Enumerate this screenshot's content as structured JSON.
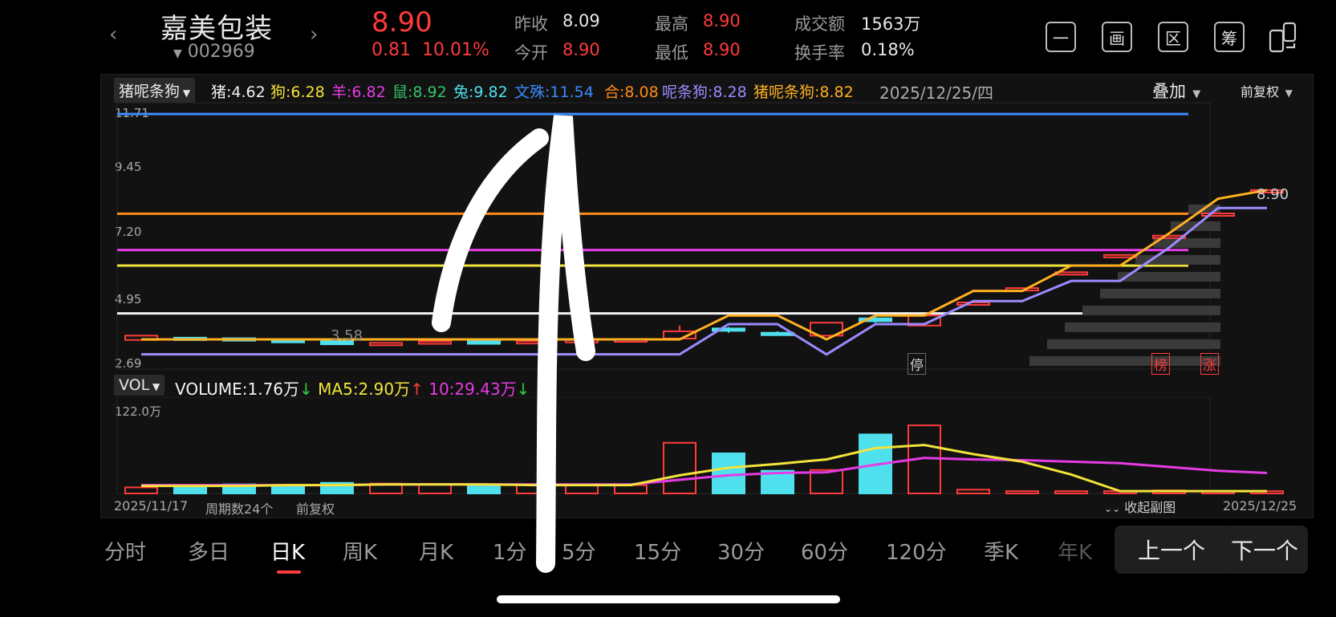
{
  "header": {
    "prev_label": "‹",
    "next_label": "›",
    "name": "嘉美包装",
    "code": "002969",
    "price": "8.90",
    "change": "0.81",
    "change_pct": "10.01%",
    "quotes": [
      {
        "label": "昨收",
        "value": "8.09",
        "color": "#e8e8e8"
      },
      {
        "label": "今开",
        "value": "8.90",
        "color": "#ff3b3b"
      },
      {
        "label": "最高",
        "value": "8.90",
        "color": "#ff3b3b"
      },
      {
        "label": "最低",
        "value": "8.90",
        "color": "#ff3b3b"
      },
      {
        "label": "成交额",
        "value": "1563万",
        "color": "#e8e8e8"
      },
      {
        "label": "换手率",
        "value": "0.18%",
        "color": "#e8e8e8"
      }
    ],
    "tools": [
      "一",
      "画",
      "区",
      "筹"
    ]
  },
  "indicator": {
    "selector": "猪呢条狗",
    "items": [
      {
        "text": "猪:4.62",
        "color": "#f2f2f2"
      },
      {
        "text": "狗:6.28",
        "color": "#f3e33a"
      },
      {
        "text": "羊:6.82",
        "color": "#e53be5"
      },
      {
        "text": "鼠:8.92",
        "color": "#36c46a"
      },
      {
        "text": "兔:9.82",
        "color": "#4fe0ee"
      },
      {
        "text": "文殊:11.54",
        "color": "#3d8bff"
      },
      {
        "text": "合:8.08",
        "color": "#ff8a1a"
      },
      {
        "text": "呢条狗:8.28",
        "color": "#9b8bff"
      },
      {
        "text": "猪呢条狗:8.82",
        "color": "#ffb020"
      }
    ],
    "date": "2025/12/25/四",
    "overlay": "叠加",
    "adjust": "前复权"
  },
  "price_axis": [
    "11.71",
    "9.45",
    "7.20",
    "4.95",
    "2.69"
  ],
  "low_label": "3.58",
  "last_label": "8.90",
  "markers": [
    {
      "text": "停",
      "color": "#cfcfcf"
    },
    {
      "text": "榜",
      "color": "#ff3b3b"
    },
    {
      "text": "涨",
      "color": "#ff3b3b"
    }
  ],
  "volume": {
    "selector": "VOL",
    "vol_text": "VOLUME:1.76万",
    "vol_arrow": "↓",
    "ma5_text": "MA5:2.90万",
    "ma5_arrow": "↑",
    "ma10_text": "10:29.43万",
    "ma10_arrow": "↓",
    "axis_max": "122.0万"
  },
  "footer": {
    "start_date": "2025/11/17",
    "period_count": "周期数24个",
    "adjust": "前复权",
    "collapse": "收起副图",
    "end_date": "2025/12/25"
  },
  "period_tabs": [
    "分时",
    "多日",
    "日K",
    "周K",
    "月K",
    "1分",
    "5分",
    "15分",
    "30分",
    "60分",
    "120分",
    "季K",
    "年K"
  ],
  "active_tab": "日K",
  "pager": {
    "prev": "上一个",
    "next": "下一个"
  },
  "chart_data": {
    "type": "candlestick",
    "ylim": [
      2.69,
      11.71
    ],
    "horizontal_lines": [
      {
        "value": 11.54,
        "color": "#3d8bff"
      },
      {
        "value": 8.08,
        "color": "#ff8a1a"
      },
      {
        "value": 6.82,
        "color": "#e53be5"
      },
      {
        "value": 6.28,
        "color": "#f3e33a"
      },
      {
        "value": 4.62,
        "color": "#f2f2f2"
      }
    ],
    "candles": [
      {
        "o": 3.85,
        "c": 3.7,
        "h": 3.85,
        "l": 3.7,
        "up": true
      },
      {
        "o": 3.78,
        "c": 3.74,
        "h": 3.78,
        "l": 3.72,
        "up": false
      },
      {
        "o": 3.76,
        "c": 3.72,
        "h": 3.76,
        "l": 3.7,
        "up": false
      },
      {
        "o": 3.7,
        "c": 3.68,
        "h": 3.72,
        "l": 3.66,
        "up": false
      },
      {
        "o": 3.7,
        "c": 3.55,
        "h": 3.72,
        "l": 3.55,
        "up": false
      },
      {
        "o": 3.6,
        "c": 3.58,
        "h": 3.6,
        "l": 3.55,
        "up": true
      },
      {
        "o": 3.6,
        "c": 3.65,
        "h": 3.65,
        "l": 3.6,
        "up": true
      },
      {
        "o": 3.65,
        "c": 3.62,
        "h": 3.66,
        "l": 3.6,
        "up": false
      },
      {
        "o": 3.6,
        "c": 3.66,
        "h": 3.66,
        "l": 3.6,
        "up": true
      },
      {
        "o": 3.68,
        "c": 3.7,
        "h": 3.7,
        "l": 3.68,
        "up": true
      },
      {
        "o": 3.7,
        "c": 3.72,
        "h": 3.72,
        "l": 3.7,
        "up": true
      },
      {
        "o": 3.75,
        "c": 4.0,
        "h": 4.2,
        "l": 3.75,
        "up": true
      },
      {
        "o": 4.1,
        "c": 4.05,
        "h": 4.15,
        "l": 3.95,
        "up": false
      },
      {
        "o": 3.95,
        "c": 3.9,
        "h": 4.0,
        "l": 3.85,
        "up": false
      },
      {
        "o": 3.85,
        "c": 4.3,
        "h": 4.3,
        "l": 3.85,
        "up": true
      },
      {
        "o": 4.35,
        "c": 4.45,
        "h": 4.5,
        "l": 4.3,
        "up": false
      },
      {
        "o": 4.2,
        "c": 4.55,
        "h": 4.55,
        "l": 4.2,
        "up": true
      },
      {
        "o": 5.0,
        "c": 5.0,
        "h": 5.0,
        "l": 5.0,
        "up": true
      },
      {
        "o": 5.5,
        "c": 5.5,
        "h": 5.5,
        "l": 5.5,
        "up": true
      },
      {
        "o": 6.05,
        "c": 6.05,
        "h": 6.05,
        "l": 6.05,
        "up": true
      },
      {
        "o": 6.65,
        "c": 6.65,
        "h": 6.65,
        "l": 6.65,
        "up": true
      },
      {
        "o": 7.32,
        "c": 7.32,
        "h": 7.32,
        "l": 7.32,
        "up": true
      },
      {
        "o": 8.09,
        "c": 8.09,
        "h": 8.09,
        "l": 8.09,
        "up": true
      },
      {
        "o": 8.9,
        "c": 8.9,
        "h": 8.9,
        "l": 8.9,
        "up": true
      }
    ],
    "line_yellow": [
      3.72,
      3.72,
      3.72,
      3.72,
      3.72,
      3.72,
      3.72,
      3.72,
      3.72,
      3.72,
      3.72,
      3.72,
      4.55,
      4.55,
      3.72,
      4.55,
      4.55,
      5.4,
      5.4,
      6.28,
      6.28,
      7.4,
      8.6,
      8.9
    ],
    "line_purple": [
      3.2,
      3.2,
      3.2,
      3.2,
      3.2,
      3.2,
      3.2,
      3.2,
      3.2,
      3.2,
      3.2,
      3.2,
      4.25,
      4.25,
      3.2,
      4.25,
      4.25,
      5.05,
      5.05,
      5.75,
      5.75,
      6.9,
      8.28,
      8.28
    ],
    "volume_bars": [
      8,
      9,
      12,
      9,
      14,
      13,
      12,
      10,
      11,
      11,
      11,
      67,
      53,
      30,
      31,
      78,
      90,
      5,
      3,
      3,
      3,
      4,
      3,
      3
    ],
    "volume_up": [
      true,
      false,
      false,
      false,
      false,
      true,
      true,
      false,
      true,
      true,
      true,
      true,
      false,
      false,
      true,
      false,
      true,
      true,
      true,
      true,
      true,
      true,
      true,
      true
    ],
    "ma5": [
      10,
      10,
      10,
      11,
      11,
      12,
      12,
      12,
      11,
      11,
      11,
      24,
      34,
      39,
      45,
      60,
      64,
      52,
      42,
      25,
      3,
      3,
      3,
      3
    ],
    "ma10": [
      11,
      11,
      11,
      11,
      11,
      12,
      12,
      12,
      12,
      12,
      12,
      18,
      24,
      27,
      28,
      38,
      47,
      45,
      44,
      42,
      40,
      35,
      30,
      27
    ],
    "vol_ylim": [
      0,
      122
    ]
  }
}
